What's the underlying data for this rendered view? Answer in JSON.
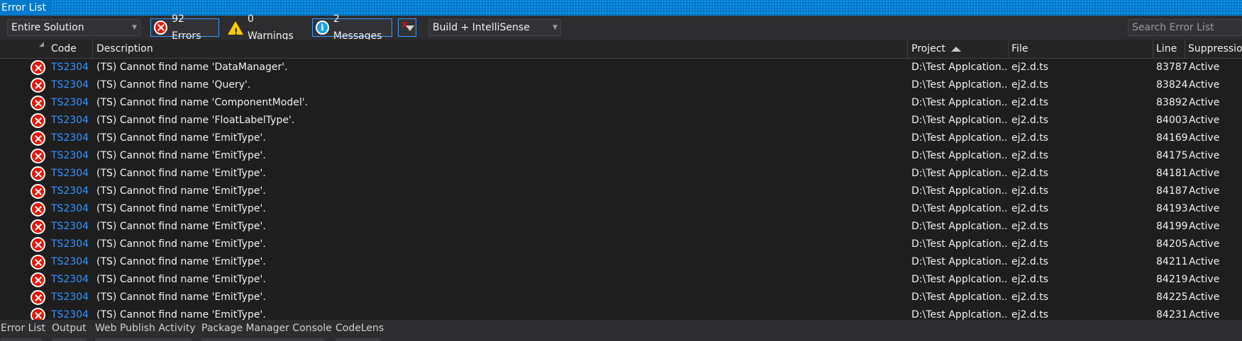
{
  "window": {
    "title": "Error List"
  },
  "toolbar": {
    "scope": "Entire Solution",
    "errors_label": "92 Errors",
    "warnings_label": "0 Warnings",
    "messages_label": "2 Messages",
    "build_filter": "Build + IntelliSense",
    "search_placeholder": "Search Error List"
  },
  "columns": {
    "code": "Code",
    "description": "Description",
    "project": "Project",
    "file": "File",
    "line": "Line",
    "suppression": "Suppression State"
  },
  "rows": [
    {
      "code": "TS2304",
      "description": "(TS) Cannot find name 'DataManager'.",
      "project": "D:\\Test Applcation...",
      "file": "ej2.d.ts",
      "line": "83787",
      "suppression": "Active"
    },
    {
      "code": "TS2304",
      "description": "(TS) Cannot find name 'Query'.",
      "project": "D:\\Test Applcation...",
      "file": "ej2.d.ts",
      "line": "83824",
      "suppression": "Active"
    },
    {
      "code": "TS2304",
      "description": "(TS) Cannot find name 'ComponentModel'.",
      "project": "D:\\Test Applcation...",
      "file": "ej2.d.ts",
      "line": "83892",
      "suppression": "Active"
    },
    {
      "code": "TS2304",
      "description": "(TS) Cannot find name 'FloatLabelType'.",
      "project": "D:\\Test Applcation...",
      "file": "ej2.d.ts",
      "line": "84003",
      "suppression": "Active"
    },
    {
      "code": "TS2304",
      "description": "(TS) Cannot find name 'EmitType'.",
      "project": "D:\\Test Applcation...",
      "file": "ej2.d.ts",
      "line": "84169",
      "suppression": "Active"
    },
    {
      "code": "TS2304",
      "description": "(TS) Cannot find name 'EmitType'.",
      "project": "D:\\Test Applcation...",
      "file": "ej2.d.ts",
      "line": "84175",
      "suppression": "Active"
    },
    {
      "code": "TS2304",
      "description": "(TS) Cannot find name 'EmitType'.",
      "project": "D:\\Test Applcation...",
      "file": "ej2.d.ts",
      "line": "84181",
      "suppression": "Active"
    },
    {
      "code": "TS2304",
      "description": "(TS) Cannot find name 'EmitType'.",
      "project": "D:\\Test Applcation...",
      "file": "ej2.d.ts",
      "line": "84187",
      "suppression": "Active"
    },
    {
      "code": "TS2304",
      "description": "(TS) Cannot find name 'EmitType'.",
      "project": "D:\\Test Applcation...",
      "file": "ej2.d.ts",
      "line": "84193",
      "suppression": "Active"
    },
    {
      "code": "TS2304",
      "description": "(TS) Cannot find name 'EmitType'.",
      "project": "D:\\Test Applcation...",
      "file": "ej2.d.ts",
      "line": "84199",
      "suppression": "Active"
    },
    {
      "code": "TS2304",
      "description": "(TS) Cannot find name 'EmitType'.",
      "project": "D:\\Test Applcation...",
      "file": "ej2.d.ts",
      "line": "84205",
      "suppression": "Active"
    },
    {
      "code": "TS2304",
      "description": "(TS) Cannot find name 'EmitType'.",
      "project": "D:\\Test Applcation...",
      "file": "ej2.d.ts",
      "line": "84211",
      "suppression": "Active"
    },
    {
      "code": "TS2304",
      "description": "(TS) Cannot find name 'EmitType'.",
      "project": "D:\\Test Applcation...",
      "file": "ej2.d.ts",
      "line": "84219",
      "suppression": "Active"
    },
    {
      "code": "TS2304",
      "description": "(TS) Cannot find name 'EmitType'.",
      "project": "D:\\Test Applcation...",
      "file": "ej2.d.ts",
      "line": "84225",
      "suppression": "Active"
    },
    {
      "code": "TS2304",
      "description": "(TS) Cannot find name 'EmitType'.",
      "project": "D:\\Test Applcation...",
      "file": "ej2.d.ts",
      "line": "84231",
      "suppression": "Active"
    }
  ],
  "bottom_tabs": [
    "Error List",
    "Output",
    "Web Publish Activity",
    "Package Manager Console",
    "CodeLens"
  ]
}
